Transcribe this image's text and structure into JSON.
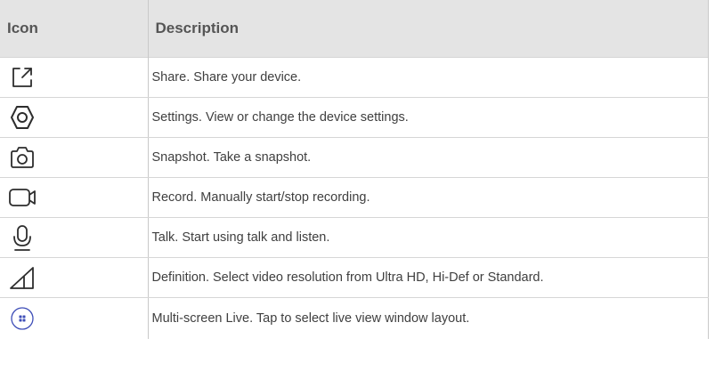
{
  "table": {
    "headers": {
      "icon": "Icon",
      "description": "Description"
    },
    "rows": [
      {
        "icon": "share-icon",
        "description": "Share. Share your device."
      },
      {
        "icon": "settings-icon",
        "description": "Settings. View or change the device settings."
      },
      {
        "icon": "snapshot-icon",
        "description": "Snapshot. Take a snapshot."
      },
      {
        "icon": "record-icon",
        "description": "Record. Manually start/stop recording."
      },
      {
        "icon": "talk-icon",
        "description": "Talk. Start using talk and listen."
      },
      {
        "icon": "definition-icon",
        "description": "Definition. Select video resolution from Ultra HD, Hi-Def or Standard."
      },
      {
        "icon": "multi-screen-live-icon",
        "description": "Multi-screen Live. Tap to select live view window layout."
      }
    ]
  },
  "colors": {
    "header_background": "#e4e4e4",
    "icon_stroke": "#2d2d2d",
    "multiscreen_accent": "#3d4db7"
  }
}
